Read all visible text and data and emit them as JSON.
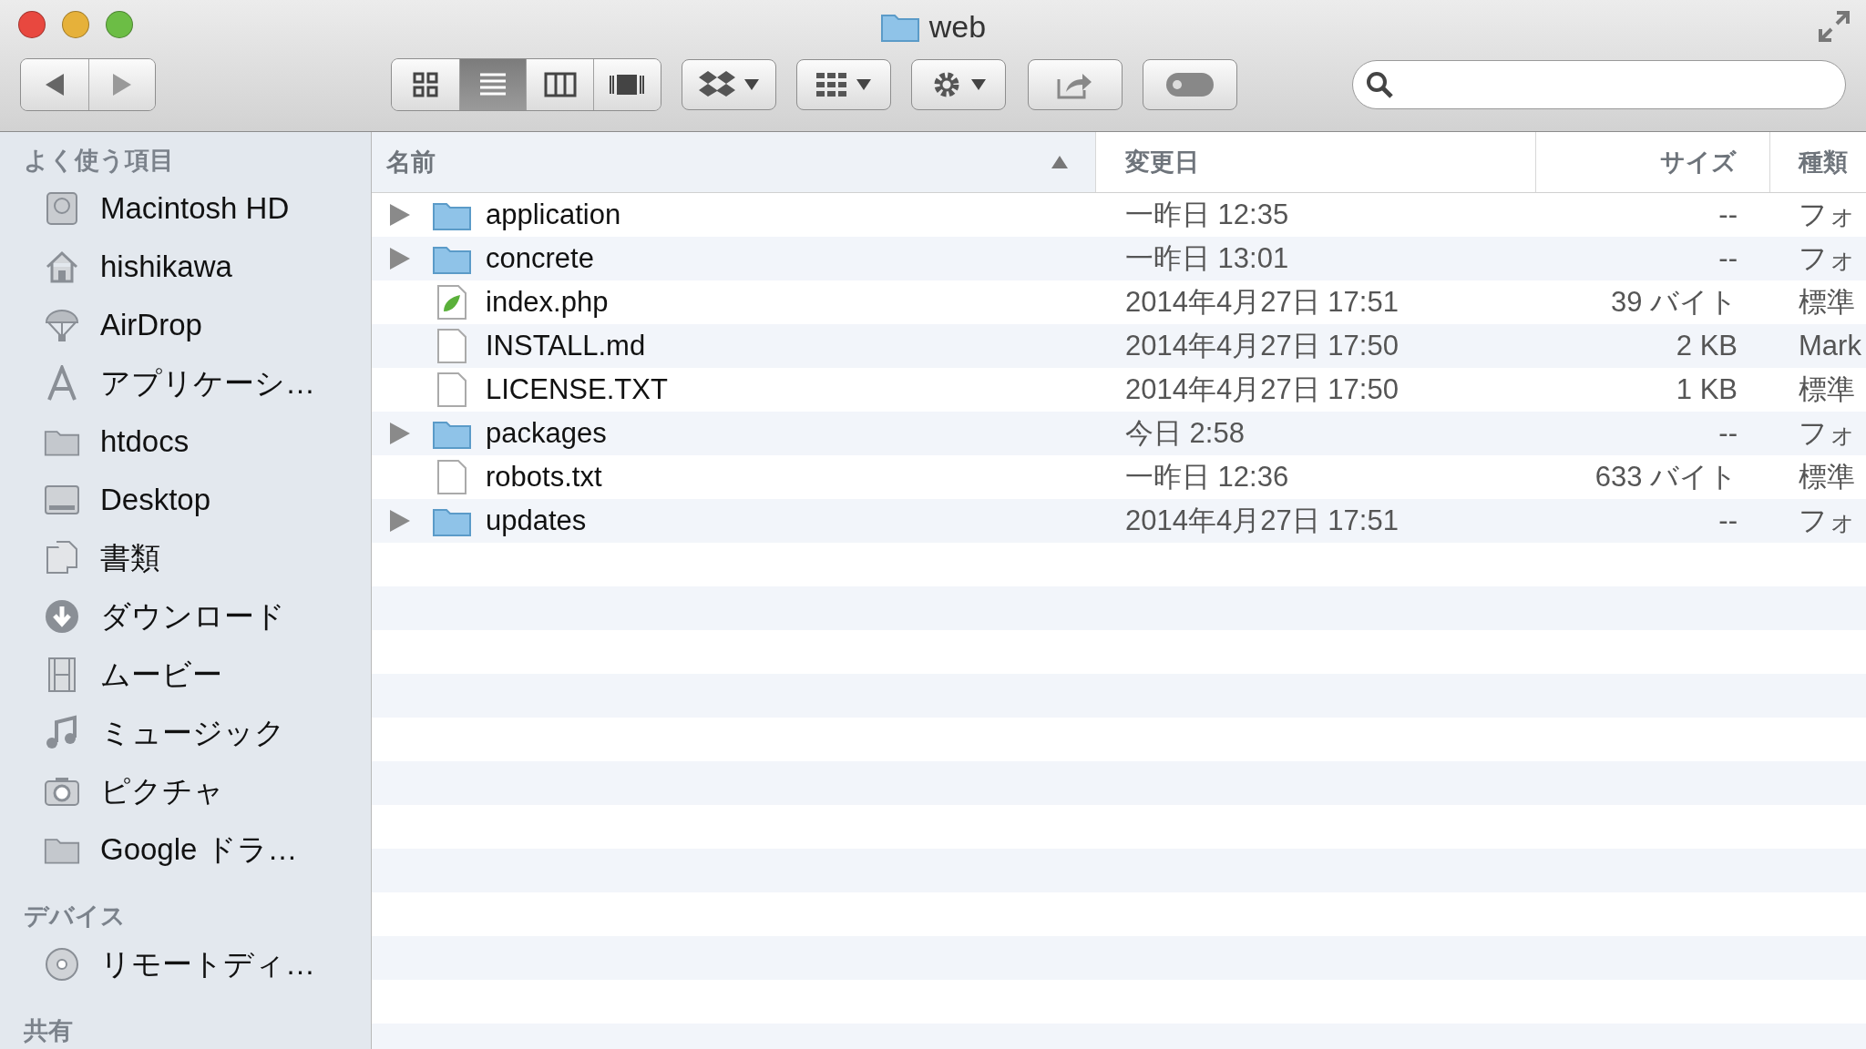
{
  "window": {
    "title": "web"
  },
  "toolbar": {
    "view_modes": [
      {
        "kind": "icons",
        "selected": false
      },
      {
        "kind": "list",
        "selected": true
      },
      {
        "kind": "columns",
        "selected": false
      },
      {
        "kind": "coverflow",
        "selected": false
      }
    ]
  },
  "sidebar": {
    "sections": [
      {
        "title": "よく使う項目",
        "items": [
          {
            "kind": "drive",
            "label": "Macintosh HD"
          },
          {
            "kind": "home",
            "label": "hishikawa"
          },
          {
            "kind": "airdrop",
            "label": "AirDrop"
          },
          {
            "kind": "apps",
            "label": "アプリケーシ…"
          },
          {
            "kind": "folder",
            "label": "htdocs"
          },
          {
            "kind": "desktop",
            "label": "Desktop"
          },
          {
            "kind": "documents",
            "label": "書類"
          },
          {
            "kind": "downloads",
            "label": "ダウンロード"
          },
          {
            "kind": "movies",
            "label": "ムービー"
          },
          {
            "kind": "music",
            "label": "ミュージック"
          },
          {
            "kind": "pictures",
            "label": "ピクチャ"
          },
          {
            "kind": "folder",
            "label": "Google ドラ…"
          }
        ]
      },
      {
        "title": "デバイス",
        "items": [
          {
            "kind": "disc",
            "label": "リモートディ…"
          }
        ]
      },
      {
        "title": "共有"
      }
    ]
  },
  "table": {
    "columns": [
      {
        "label": "名前",
        "sorted": true
      },
      {
        "label": "変更日",
        "sorted": false
      },
      {
        "label": "サイズ",
        "sorted": false
      },
      {
        "label": "種類",
        "sorted": false
      }
    ],
    "rows": [
      {
        "kind": "folder",
        "name": "application",
        "date": "一昨日 12:35",
        "size": "--",
        "type": "フォ"
      },
      {
        "kind": "folder",
        "name": "concrete",
        "date": "一昨日 13:01",
        "size": "--",
        "type": "フォ"
      },
      {
        "kind": "php",
        "name": "index.php",
        "date": "2014年4月27日 17:51",
        "size": "39 バイト",
        "type": "標準"
      },
      {
        "kind": "file",
        "name": "INSTALL.md",
        "date": "2014年4月27日 17:50",
        "size": "2 KB",
        "type": "Mark"
      },
      {
        "kind": "file",
        "name": "LICENSE.TXT",
        "date": "2014年4月27日 17:50",
        "size": "1 KB",
        "type": "標準"
      },
      {
        "kind": "folder",
        "name": "packages",
        "date": "今日 2:58",
        "size": "--",
        "type": "フォ"
      },
      {
        "kind": "file",
        "name": "robots.txt",
        "date": "一昨日 12:36",
        "size": "633 バイト",
        "type": "標準"
      },
      {
        "kind": "folder",
        "name": "updates",
        "date": "2014年4月27日 17:51",
        "size": "--",
        "type": "フォ"
      }
    ]
  }
}
